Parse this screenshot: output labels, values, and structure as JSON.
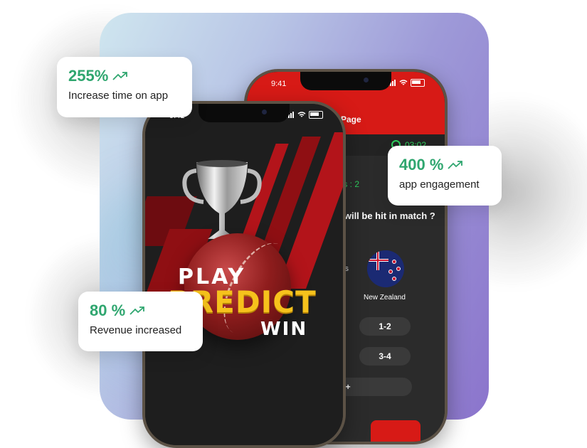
{
  "stats": [
    {
      "value": "255%",
      "label": "Increase time on app"
    },
    {
      "value": "400 %",
      "label": "app engagement"
    },
    {
      "value": "80 %",
      "label": "Revenue increased"
    }
  ],
  "back_phone": {
    "status_time": "9:41",
    "header_title": "st Page",
    "timer": "03:02",
    "points": "ts : 2",
    "question": "s will be hit in match ?",
    "team_fragment": "ys",
    "team_name": "New Zealand",
    "options": [
      "1-2",
      "3-4",
      "4+"
    ]
  },
  "front_phone": {
    "status_time": "9:41",
    "promo_line1": "PLAY",
    "promo_line2": "PREDICT",
    "promo_line3": "WIN"
  },
  "colors": {
    "accent_green": "#2fa66f",
    "brand_red": "#d71a16",
    "promo_yellow": "#f6c21c"
  }
}
